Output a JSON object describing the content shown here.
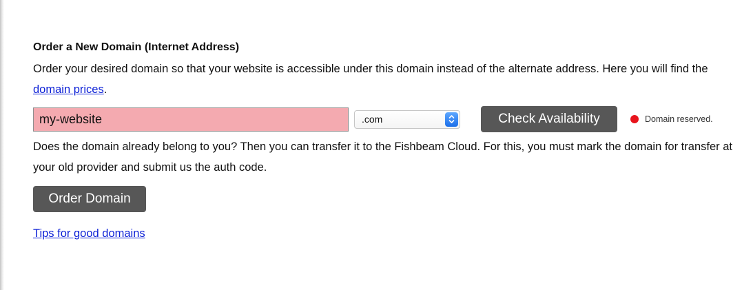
{
  "section": {
    "heading": "Order a New Domain (Internet Address)",
    "intro_text": "Order your desired domain so that your website is accessible under this domain instead of the alternate address. Here you will find the",
    "prices_link": "domain prices",
    "intro_end": "."
  },
  "domain_form": {
    "input_value": "my-website",
    "input_bg_color": "#f4aab0",
    "tld_selected": ".com",
    "check_button": "Check Availability",
    "status_text": "Domain reserved.",
    "status_color": "#e8141c",
    "status_icon": "red-dot-icon",
    "select_icon": "updown-chevron-icon"
  },
  "transfer": {
    "text": "Does the domain already belong to you? Then you can transfer it to the Fishbeam Cloud. For this, you must mark the domain for transfer at your old provider and submit us the auth code."
  },
  "order_button": "Order Domain",
  "tips_link": "Tips for good domains",
  "colors": {
    "button_bg": "#575757",
    "link": "#0b1fd6"
  }
}
